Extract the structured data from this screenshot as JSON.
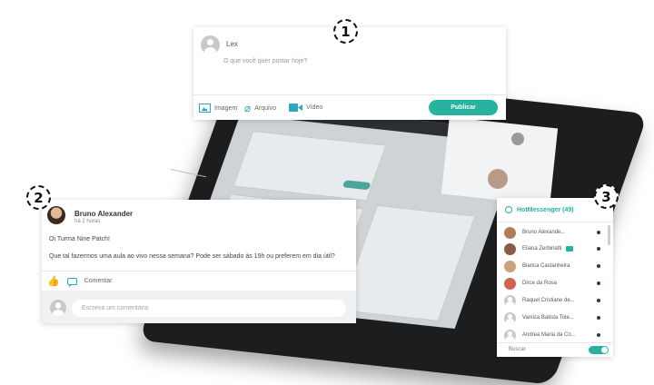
{
  "composer": {
    "user_name": "Lex",
    "placeholder": "O que você quer postar hoje?",
    "actions": [
      {
        "label": "Imagem",
        "icon": "image-icon"
      },
      {
        "label": "Arquivo",
        "icon": "attachment-icon"
      },
      {
        "label": "Vídeo",
        "icon": "video-icon"
      }
    ],
    "publish_label": "Publicar"
  },
  "post": {
    "author": "Bruno Alexander",
    "time": "há 2 horas",
    "lines": [
      "Oi Turma Nine Patch!",
      "Que tal fazermos uma aula ao vivo nessa semana? Pode ser sábado às 19h ou preferem em dia útil?"
    ],
    "comment_label": "Comentar",
    "comment_placeholder": "Escreva um comentário"
  },
  "messenger": {
    "title": "HotMessenger (49)",
    "contacts": [
      {
        "name": "Bruno Alexande...",
        "color": "#b07d5c"
      },
      {
        "name": "Eliana Zerbinatti",
        "color": "#8a5a44"
      },
      {
        "name": "Bianca Castanheira",
        "color": "#c9a27e"
      },
      {
        "name": "Dirce da Rosa",
        "color": "#d4604d"
      },
      {
        "name": "Raquel Cristiane de...",
        "color": "#bdbdbd"
      },
      {
        "name": "Vaniiza Batista Tole...",
        "color": "#bdbdbd"
      },
      {
        "name": "Andrea Maria da Co...",
        "color": "#bdbdbd"
      }
    ],
    "search_label": "Buscar"
  },
  "markers": [
    "1",
    "2",
    "3"
  ],
  "colors": {
    "accent": "#27b3a0",
    "icon": "#2aa8c2"
  }
}
